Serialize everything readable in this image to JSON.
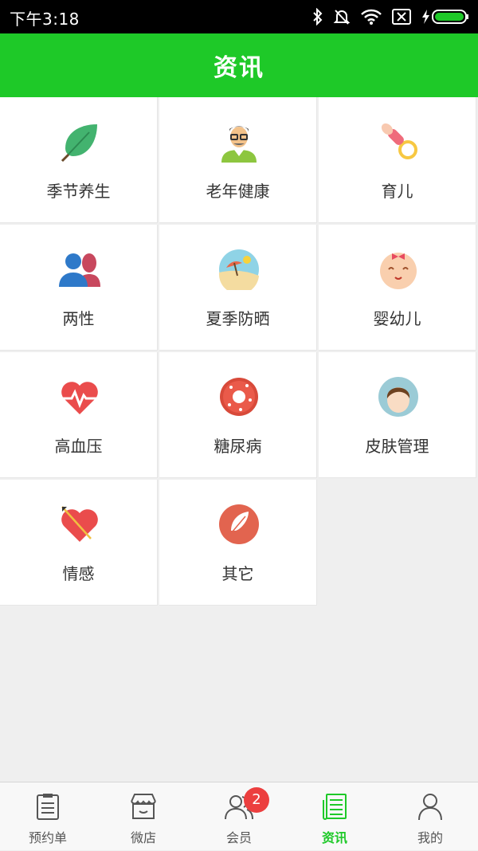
{
  "status_bar": {
    "time": "下午3:18"
  },
  "header": {
    "title": "资讯"
  },
  "categories": [
    {
      "label": "季节养生",
      "icon": "leaf-icon"
    },
    {
      "label": "老年健康",
      "icon": "elderly-man-icon"
    },
    {
      "label": "育儿",
      "icon": "pacifier-icon"
    },
    {
      "label": "两性",
      "icon": "couple-icon"
    },
    {
      "label": "夏季防晒",
      "icon": "beach-umbrella-icon"
    },
    {
      "label": "婴幼儿",
      "icon": "baby-face-icon"
    },
    {
      "label": "高血压",
      "icon": "heartbeat-icon"
    },
    {
      "label": "糖尿病",
      "icon": "donut-icon"
    },
    {
      "label": "皮肤管理",
      "icon": "face-icon"
    },
    {
      "label": "情感",
      "icon": "heart-arrow-icon"
    },
    {
      "label": "其它",
      "icon": "feather-icon"
    }
  ],
  "tabbar": {
    "tabs": [
      {
        "label": "预约单",
        "icon": "clipboard-icon",
        "active": false
      },
      {
        "label": "微店",
        "icon": "shop-icon",
        "active": false
      },
      {
        "label": "会员",
        "icon": "members-icon",
        "active": false,
        "badge": "2"
      },
      {
        "label": "资讯",
        "icon": "news-icon",
        "active": true
      },
      {
        "label": "我的",
        "icon": "profile-icon",
        "active": false
      }
    ]
  },
  "colors": {
    "accent": "#1ec928",
    "badge": "#ec3f3f",
    "background": "#efefef"
  }
}
